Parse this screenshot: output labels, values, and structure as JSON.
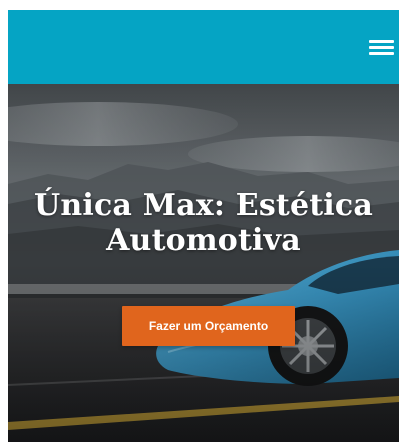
{
  "header": {
    "menu_icon": "hamburger-menu-icon",
    "bar_color": "#05a4c4"
  },
  "hero": {
    "title_line1": "Única Max: Estética",
    "title_line2": "Automotiva",
    "background_image": "blue sports car on highway with mountains",
    "cta_label": "Fazer um Orçamento",
    "cta_color": "#e0651d"
  }
}
